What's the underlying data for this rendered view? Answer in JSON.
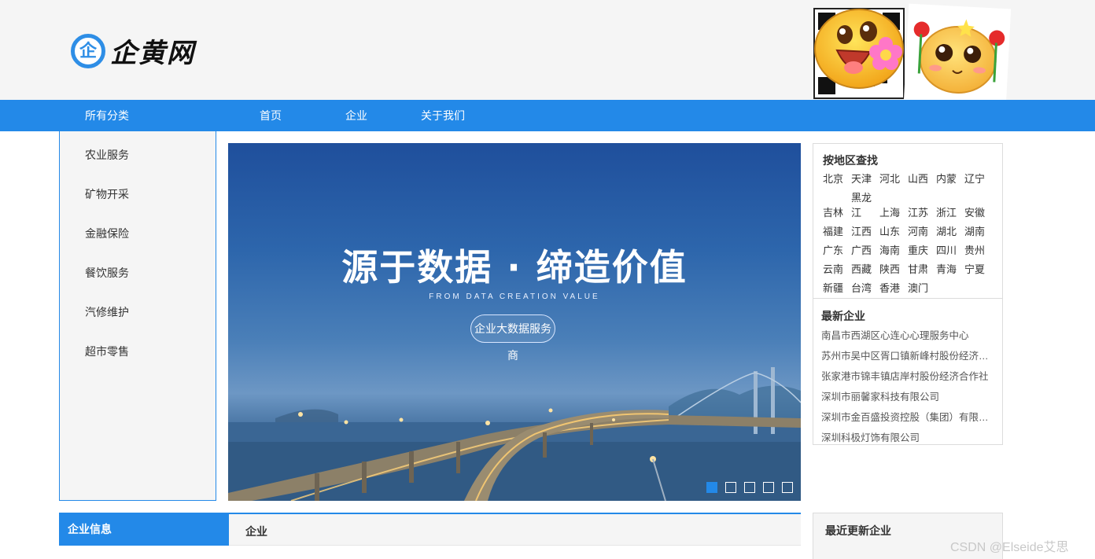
{
  "header": {
    "logo_mark": "企",
    "logo_text": "企黄网"
  },
  "nav": {
    "all_categories": "所有分类",
    "items": [
      "首页",
      "企业",
      "关于我们"
    ]
  },
  "categories": [
    "农业服务",
    "矿物开采",
    "金融保险",
    "餐饮服务",
    "汽修维护",
    "超市零售"
  ],
  "banner": {
    "title": "源于数据 · 缔造价值",
    "subtitle": "FROM DATA CREATION VALUE",
    "pill": "企业大数据服务商",
    "slide_count": 5,
    "active_slide": 1
  },
  "region": {
    "title": "按地区查找",
    "regions": [
      "北京",
      "天津",
      "河北",
      "山西",
      "内蒙",
      "辽宁",
      "吉林",
      "黑龙江",
      "上海",
      "江苏",
      "浙江",
      "安徽",
      "福建",
      "江西",
      "山东",
      "河南",
      "湖北",
      "湖南",
      "广东",
      "广西",
      "海南",
      "重庆",
      "四川",
      "贵州",
      "云南",
      "西藏",
      "陕西",
      "甘肃",
      "青海",
      "宁夏",
      "新疆",
      "台湾",
      "香港",
      "澳门"
    ]
  },
  "latest": {
    "title": "最新企业",
    "items": [
      "南昌市西湖区心连心心理服务中心",
      "苏州市吴中区胥口镇新峰村股份经济合作社",
      "张家港市锦丰镇店岸村股份经济合作社",
      "深圳市丽馨家科技有限公司",
      "深圳市金百盛投资控股（集团）有限公司",
      "深圳科极灯饰有限公司"
    ]
  },
  "bottom": {
    "left_title": "企业信息",
    "mid_title": "企业",
    "right_title": "最近更新企业"
  },
  "watermark": "CSDN @Elseide艾思",
  "colors": {
    "accent": "#2389e8",
    "header_bg": "#f5f5f5"
  }
}
